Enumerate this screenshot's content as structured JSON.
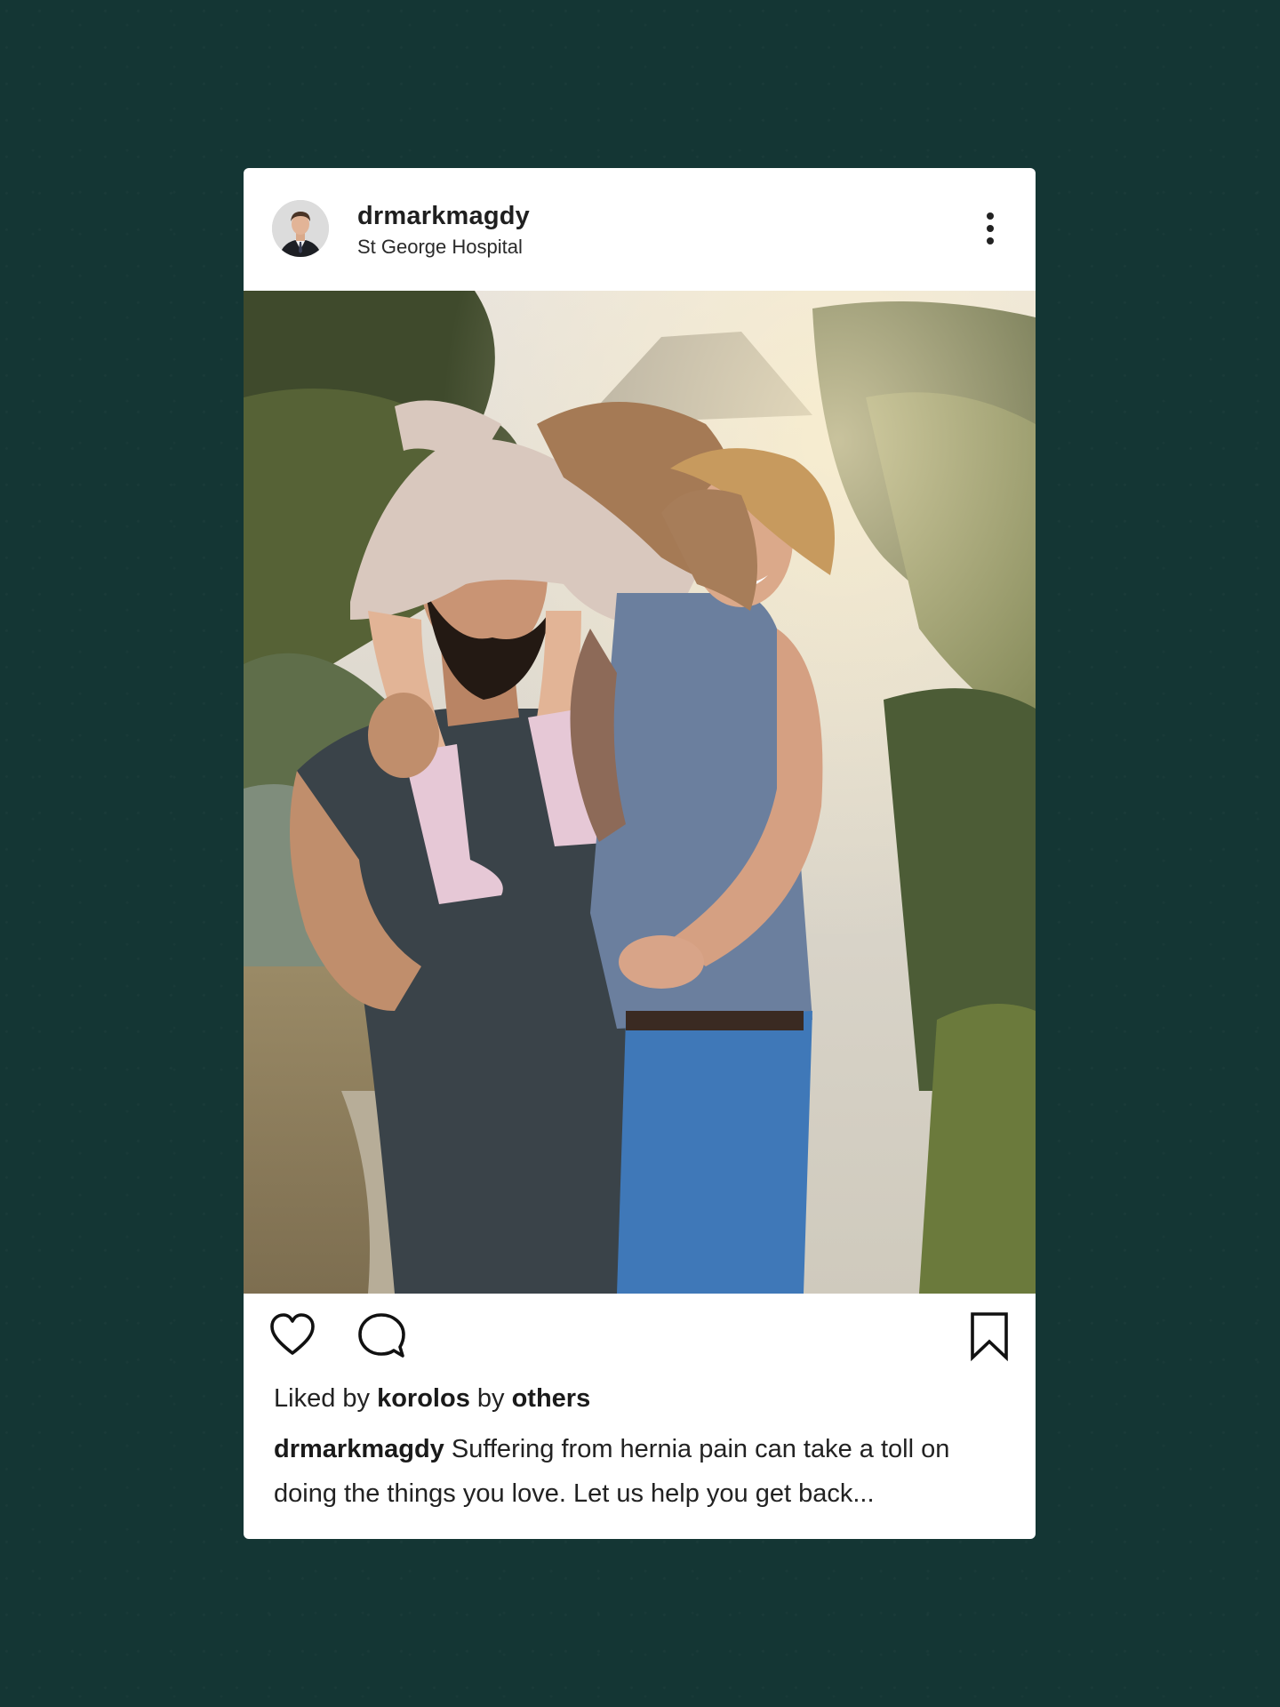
{
  "post": {
    "username": "drmarkmagdy",
    "location": "St George Hospital",
    "likes": {
      "prefix": "Liked by",
      "user": "korolos",
      "middle": "by",
      "others": "others"
    },
    "caption": {
      "author": "drmarkmagdy",
      "text": "Suffering from hernia pain can take a toll on doing the things you love. Let us help you get back..."
    }
  },
  "icons": {
    "more": "more-vertical-icon",
    "tag": "user-tag-icon",
    "like": "heart-icon",
    "comment": "comment-icon",
    "save": "bookmark-icon"
  },
  "colors": {
    "page_background": "#143634",
    "card_background": "#ffffff",
    "text": "#1f1f1f"
  }
}
